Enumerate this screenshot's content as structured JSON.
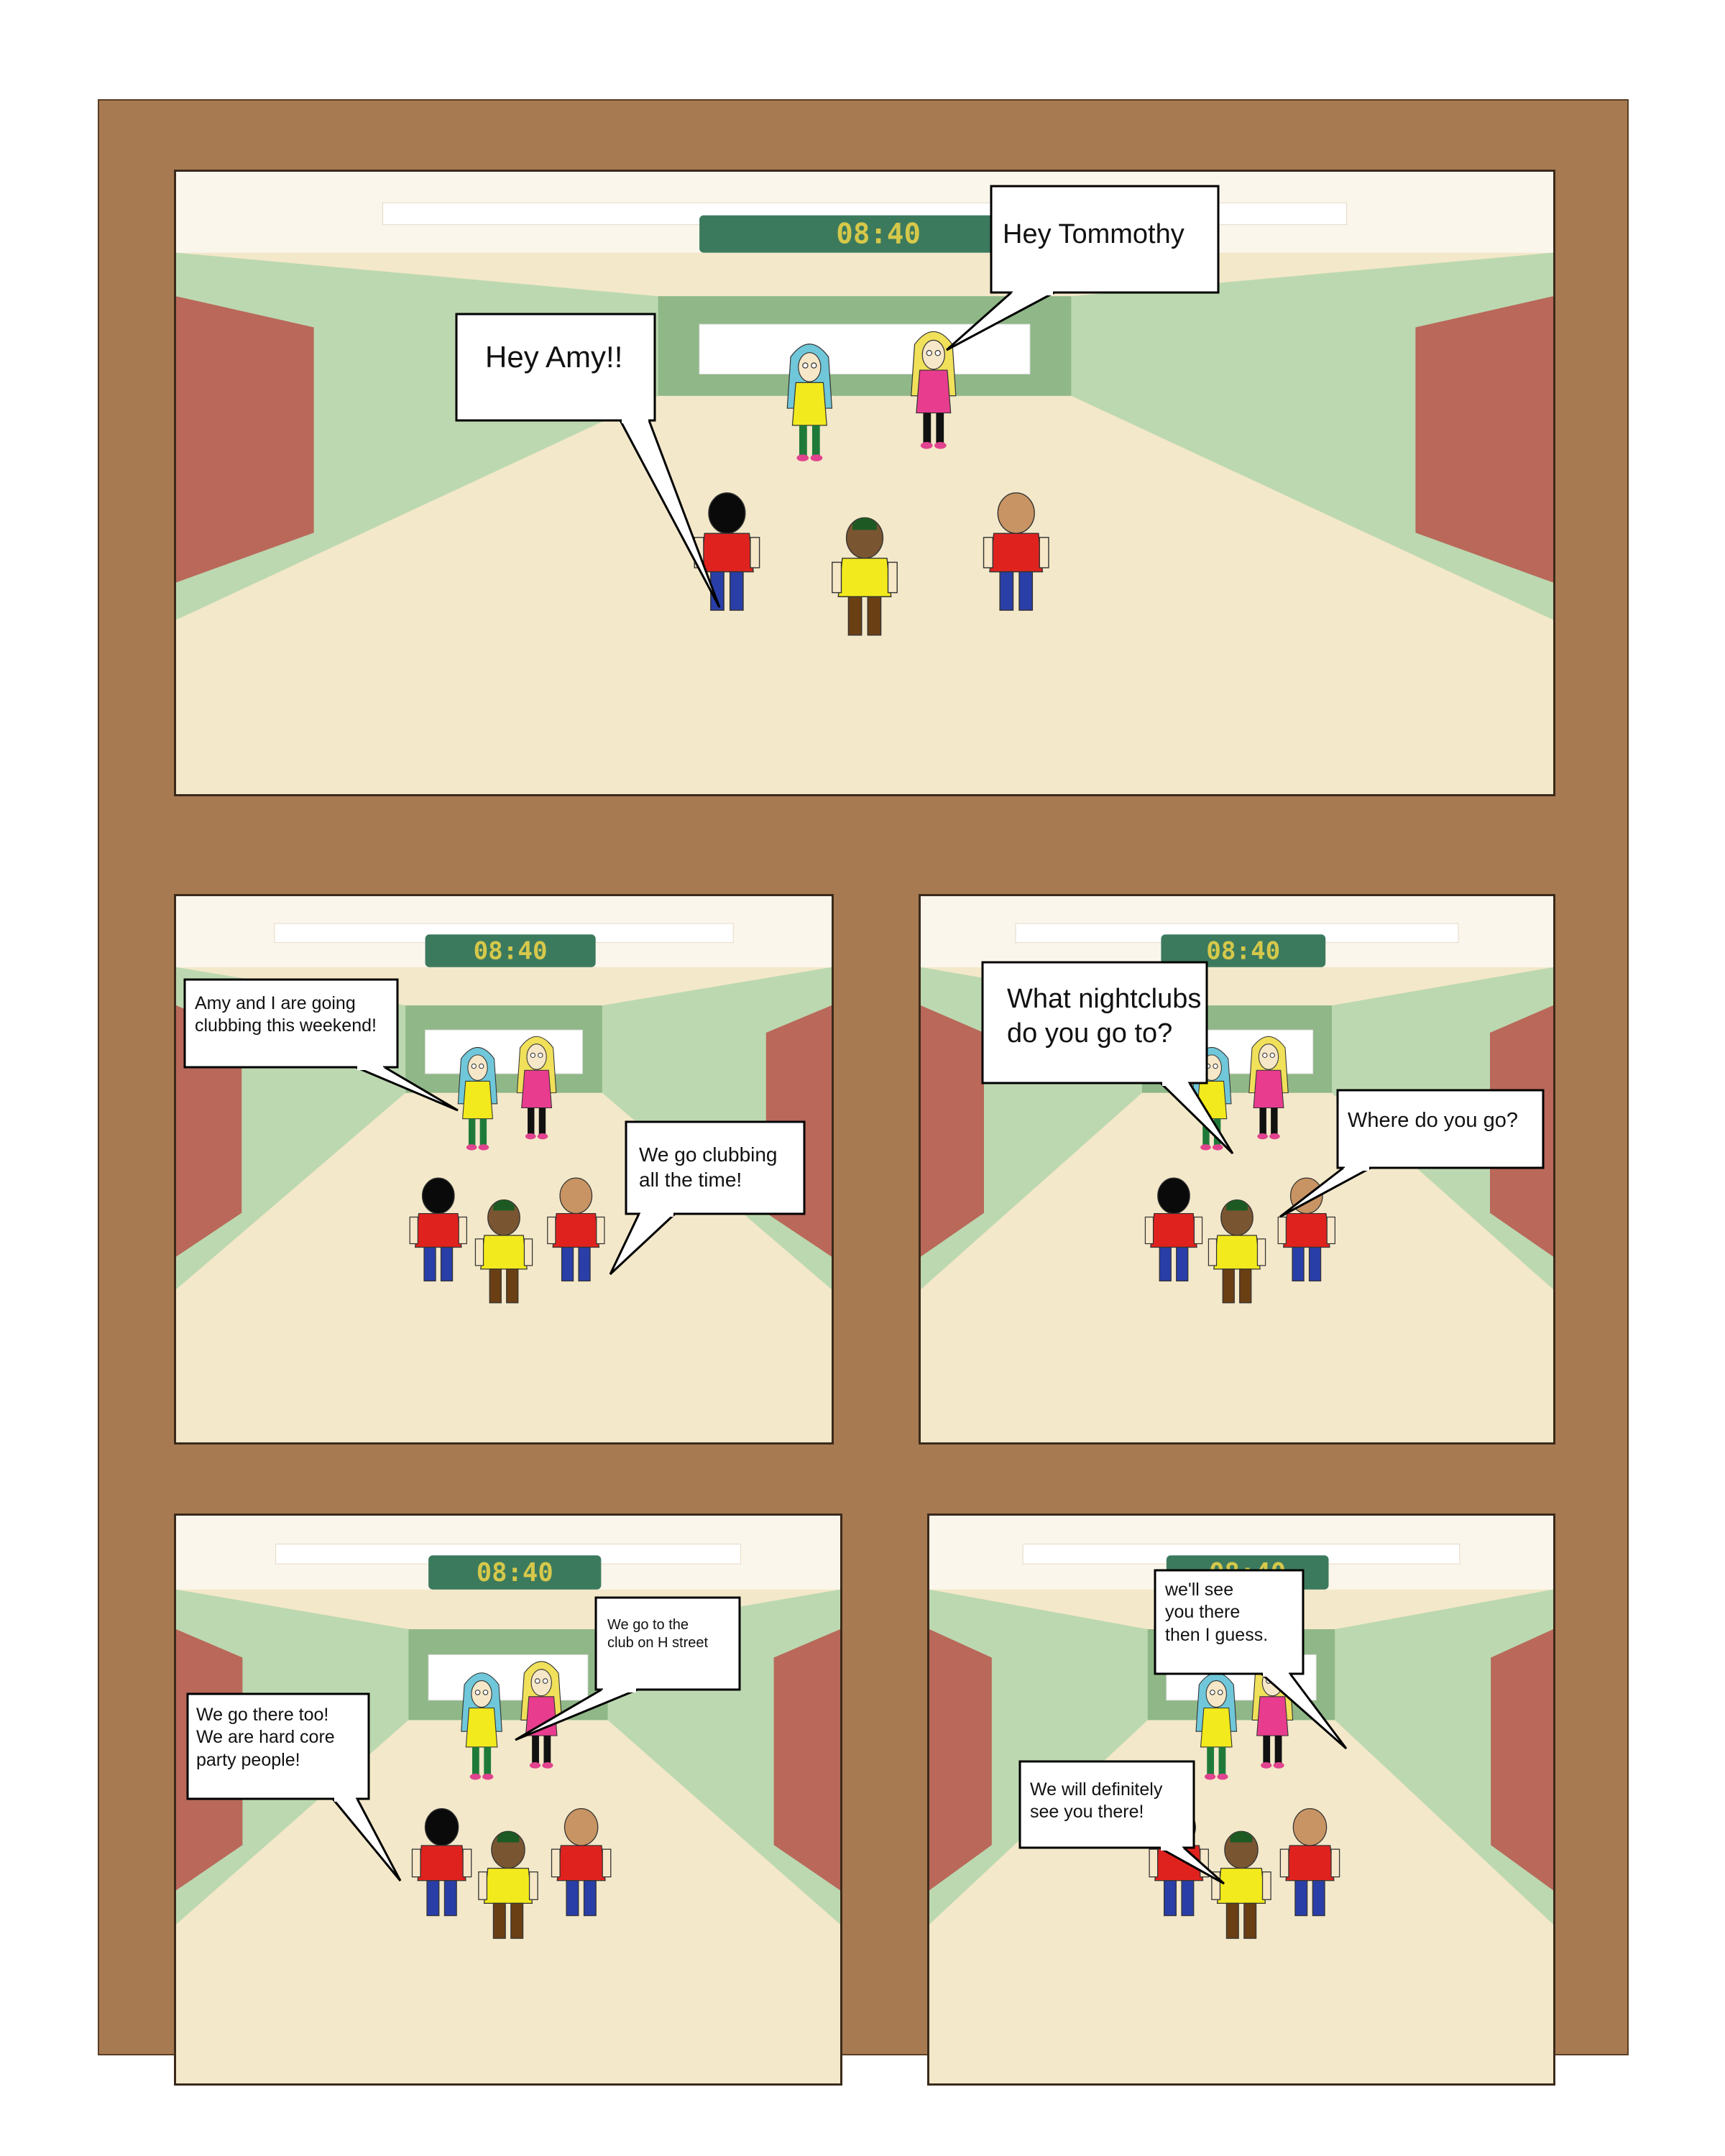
{
  "clock_text": "08:40",
  "panels": [
    {
      "bubbles": [
        "Hey Amy!!",
        "Hey Tommothy"
      ]
    },
    {
      "bubbles": [
        "Amy and I are going\nclubbing this weekend!",
        "We go clubbing\nall the time!"
      ]
    },
    {
      "bubbles": [
        "What nightclubs\ndo you go to?",
        "Where do you go?"
      ]
    },
    {
      "bubbles": [
        "We go there too!\nWe are hard core\nparty people!",
        "We go to the\nclub on H street"
      ]
    },
    {
      "bubbles": [
        " we'll see\nyou there\nthen I guess.",
        "We will definitely\nsee you there!"
      ]
    }
  ],
  "colors": {
    "page_border": "#a77a52",
    "wall": "#bcd8b0",
    "wall_dark": "#8fb787",
    "floor": "#f3e8c9",
    "ceiling": "#fbf6ec",
    "door": "#b9685a",
    "clock_bg": "#3c7a5e",
    "clock_digits": "#d6c84a",
    "shirt_red": "#e0221e",
    "shirt_yellow": "#f2ea1c",
    "pants_blue": "#2a3ea8",
    "pants_green": "#1f7a3a",
    "pants_brown": "#6b3f14",
    "pink_top": "#e83c8e",
    "hair_blue": "#6fc7d9",
    "hair_blond": "#f0e05a"
  }
}
